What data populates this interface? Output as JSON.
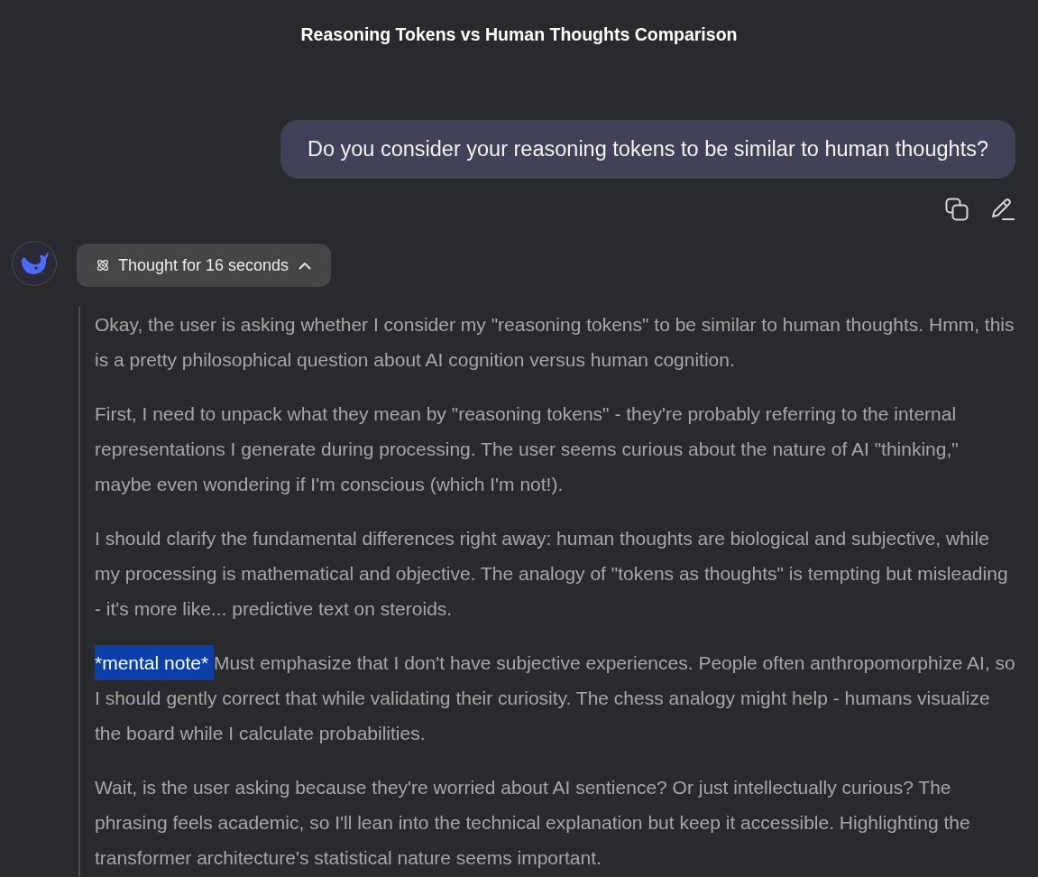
{
  "header": {
    "title": "Reasoning Tokens vs Human Thoughts Comparison"
  },
  "user_message": {
    "text": "Do you consider your reasoning tokens to be similar to human thoughts?"
  },
  "assistant": {
    "thinking_toggle": {
      "label": "Thought for 16 seconds",
      "expanded": true
    },
    "thoughts": [
      {
        "segments": [
          {
            "text": "Okay, the user is asking whether I consider my \"reasoning tokens\" to be similar to human thoughts. Hmm, this is a pretty philosophical question about AI cognition versus human cognition.",
            "selected": false
          }
        ]
      },
      {
        "segments": [
          {
            "text": "First, I need to unpack what they mean by \"reasoning tokens\" - they're probably referring to the internal representations I generate during processing. The user seems curious about the nature of AI \"thinking,\" maybe even wondering if I'm conscious (which I'm not!).",
            "selected": false
          }
        ]
      },
      {
        "segments": [
          {
            "text": "I should clarify the fundamental differences right away: human thoughts are biological and subjective, while my processing is mathematical and objective. The analogy of \"tokens as thoughts\" is tempting but misleading - it's more like... predictive text on steroids.",
            "selected": false
          }
        ]
      },
      {
        "segments": [
          {
            "text": "*mental note* ",
            "selected": true
          },
          {
            "text": "Must emphasize that I don't have subjective experiences. People often anthropomorphize AI, so I should gently correct that while validating their curiosity. The chess analogy might help - humans visualize the board while I calculate probabilities.",
            "selected": false
          }
        ]
      },
      {
        "segments": [
          {
            "text": "Wait, is the user asking because they're worried about AI sentience? Or just intellectually curious? The phrasing feels academic, so I'll lean into the technical explanation but keep it accessible. Highlighting the transformer architecture's statistical nature seems important.",
            "selected": false
          }
        ]
      }
    ]
  }
}
